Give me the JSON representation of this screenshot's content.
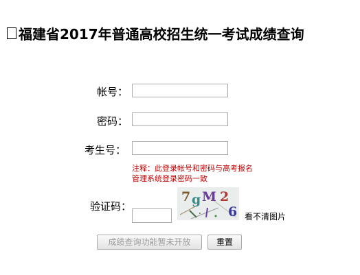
{
  "header": {
    "title": "福建省2017年普通高校招生统一考试成绩查询"
  },
  "form": {
    "account_label": "帐号：",
    "account_value": "",
    "password_label": "密码：",
    "password_value": "",
    "exam_no_label": "考生号：",
    "exam_no_value": "",
    "note_line1": "注释：此登录帐号和密码与高考报名",
    "note_line2": "管理系统登录密码一致",
    "captcha_label": "验证码：",
    "captcha_value": "",
    "captcha_text": "7gM26",
    "refresh_captcha_label": "看不清图片",
    "query_button_label": "成绩查询功能暂未开放",
    "reset_button_label": "重置"
  },
  "colors": {
    "note": "#c00000",
    "captcha_bg": "#e9eeec",
    "captcha_chars": [
      "#7a5a2a",
      "#3a8a8a",
      "#6a3aa0",
      "#b03a3a",
      "#3a3aa0"
    ]
  }
}
